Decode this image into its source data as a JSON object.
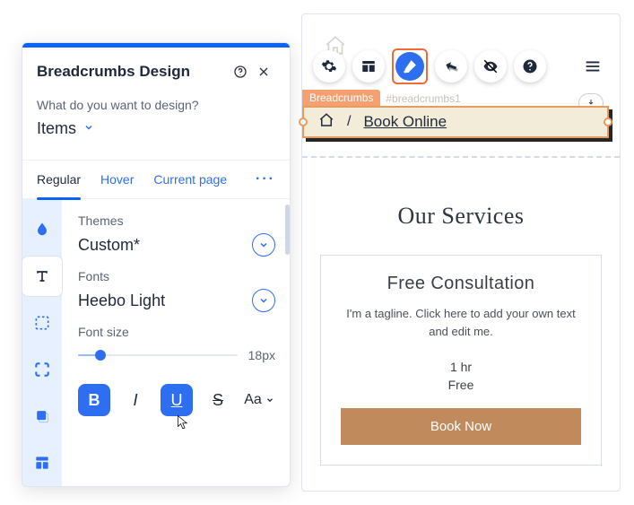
{
  "panel": {
    "title": "Breadcrumbs Design",
    "question": "What do you want to design?",
    "scope": "Items",
    "tabs": {
      "regular": "Regular",
      "hover": "Hover",
      "current": "Current page"
    },
    "themes_label": "Themes",
    "themes_value": "Custom*",
    "fonts_label": "Fonts",
    "fonts_value": "Heebo Light",
    "fontsize_label": "Font size",
    "fontsize_value": "18px",
    "fmt": {
      "bold": "B",
      "italic": "I",
      "underline": "U",
      "strike": "S",
      "case": "Aa"
    }
  },
  "canvas": {
    "bc_tag": "Breadcrumbs",
    "bc_id": "#breadcrumbs1",
    "bc_sep": "/",
    "bc_current": "Book Online",
    "heading": "Our Services",
    "card": {
      "title": "Free Consultation",
      "tagline": "I'm a tagline. Click here to add your own text and edit me.",
      "duration": "1 hr",
      "price": "Free",
      "cta": "Book Now"
    }
  }
}
